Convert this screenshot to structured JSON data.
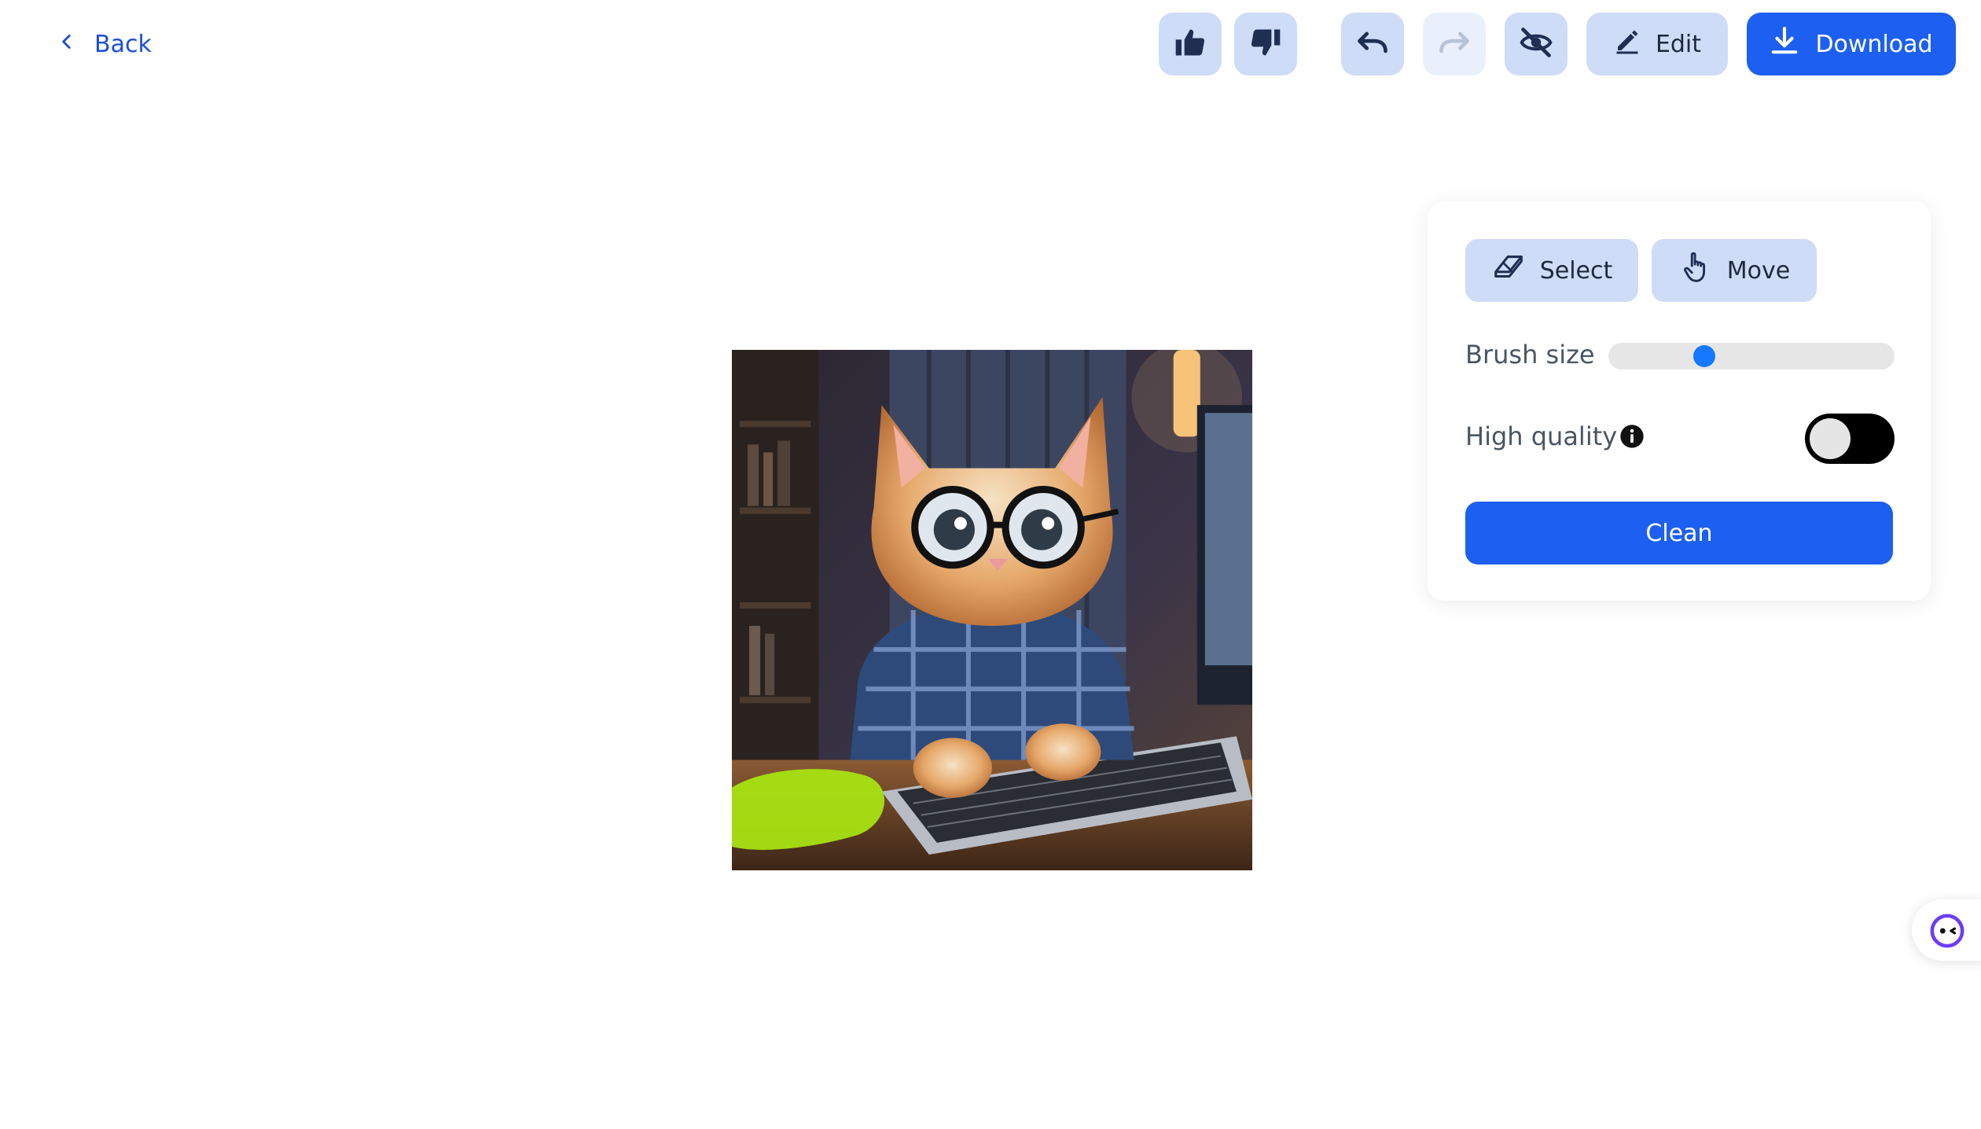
{
  "header": {
    "back_label": "Back",
    "edit_label": "Edit",
    "download_label": "Download",
    "icons": {
      "back": "chevron-left-icon",
      "like": "thumbs-up-icon",
      "dislike": "thumbs-down-icon",
      "undo": "undo-icon",
      "redo": "redo-icon",
      "hide": "eye-slash-icon",
      "edit": "pencil-icon",
      "download": "download-icon"
    },
    "redo_disabled": true
  },
  "panel": {
    "select_label": "Select",
    "move_label": "Move",
    "brush_size_label": "Brush size",
    "brush_size_level": 0.32,
    "high_quality_label": "High quality",
    "high_quality_enabled": false,
    "clean_label": "Clean",
    "icons": {
      "select": "eraser-icon",
      "move": "hand-pointer-icon",
      "info": "info-icon"
    }
  },
  "canvas": {
    "image": "kitten-with-glasses-at-laptop",
    "mask_color": "#a6e312"
  },
  "colors": {
    "accent": "#1d5ff0",
    "button_light": "#cfdcf7",
    "link": "#1d4ed8",
    "slider_thumb": "#1677ff"
  }
}
